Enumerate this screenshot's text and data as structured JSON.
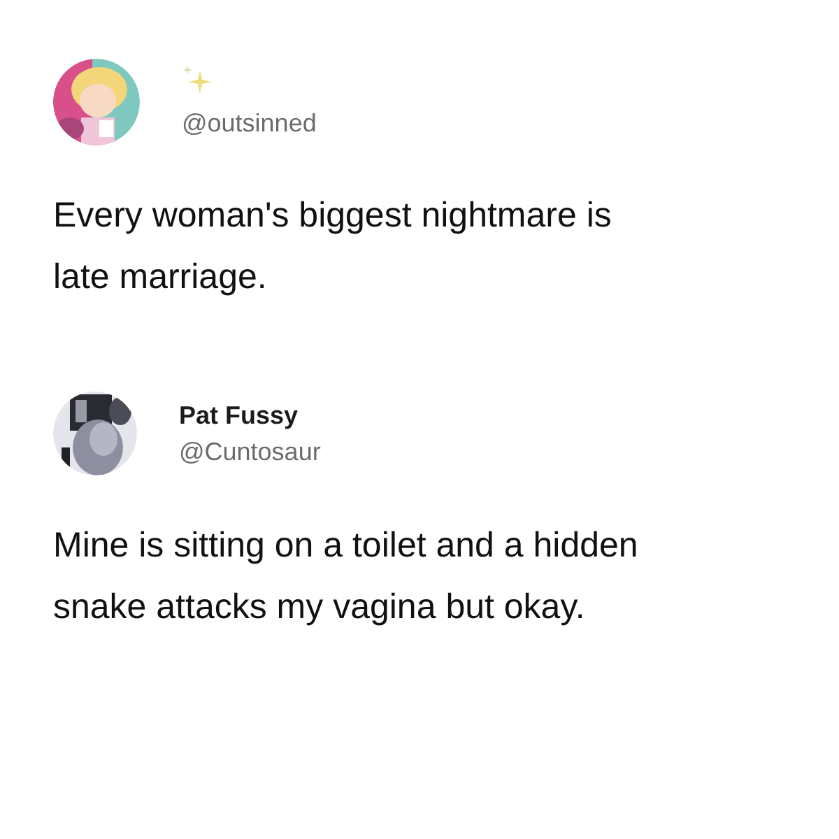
{
  "tweets": [
    {
      "handle": "@outsinned",
      "text": "Every woman's biggest nightmare is late marriage."
    },
    {
      "name": "Pat Fussy",
      "handle": "@Cuntosaur",
      "text": "Mine is sitting on a toilet and a hidden snake attacks my vagina but okay."
    }
  ]
}
